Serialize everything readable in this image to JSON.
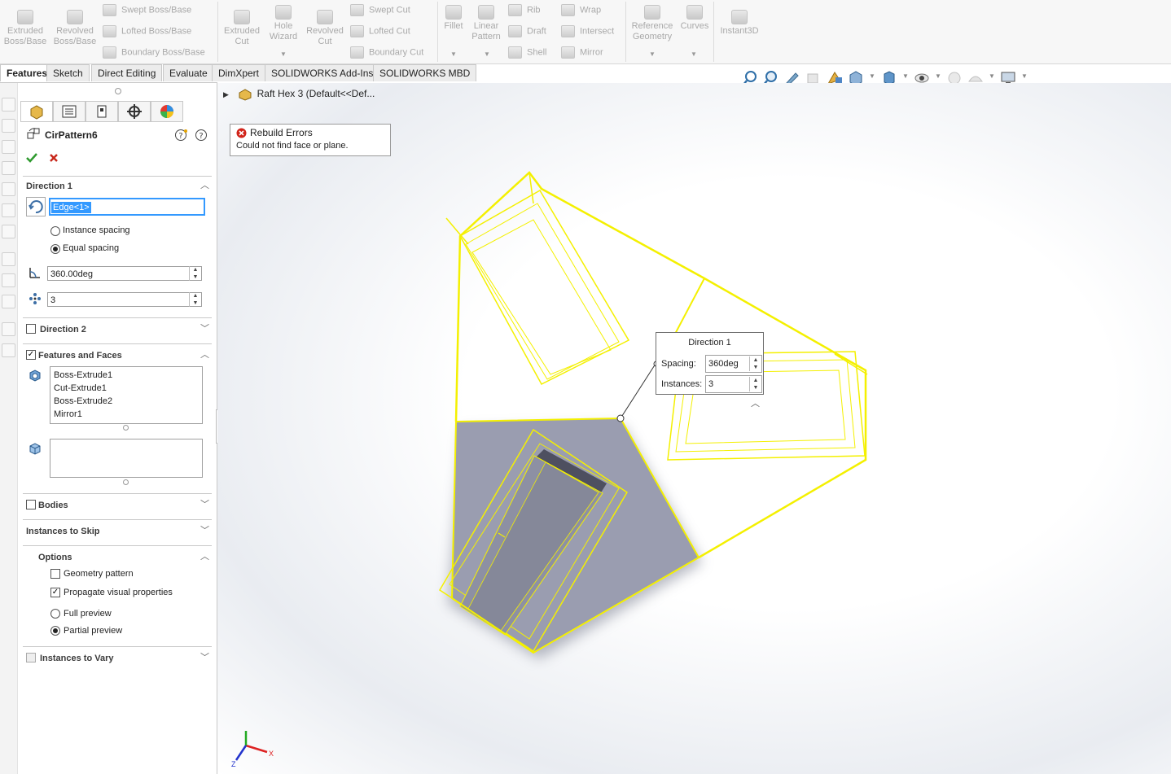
{
  "ribbon": {
    "extruded_boss": "Extruded Boss/Base",
    "revolved_boss": "Revolved Boss/Base",
    "swept_boss": "Swept Boss/Base",
    "lofted_boss": "Lofted Boss/Base",
    "boundary_boss": "Boundary Boss/Base",
    "extruded_cut": "Extruded Cut",
    "hole_wizard": "Hole Wizard",
    "revolved_cut": "Revolved Cut",
    "swept_cut": "Swept Cut",
    "lofted_cut": "Lofted Cut",
    "boundary_cut": "Boundary Cut",
    "fillet": "Fillet",
    "linear_pattern": "Linear Pattern",
    "rib": "Rib",
    "draft": "Draft",
    "shell": "Shell",
    "wrap": "Wrap",
    "intersect": "Intersect",
    "mirror": "Mirror",
    "reference_geometry": "Reference Geometry",
    "curves": "Curves",
    "instant3d": "Instant3D"
  },
  "tabs": [
    "Features",
    "Sketch",
    "Direct Editing",
    "Evaluate",
    "DimXpert",
    "SOLIDWORKS Add-Ins",
    "SOLIDWORKS MBD"
  ],
  "panel": {
    "title": "CirPattern6",
    "direction1": {
      "heading": "Direction 1",
      "edge_value": "Edge<1>",
      "instance_spacing": "Instance spacing",
      "equal_spacing": "Equal spacing",
      "angle": "360.00deg",
      "count": "3"
    },
    "direction2": {
      "heading": "Direction 2"
    },
    "features_and_faces": {
      "heading": "Features and Faces",
      "items": [
        "Boss-Extrude1",
        "Cut-Extrude1",
        "Boss-Extrude2",
        "Mirror1"
      ]
    },
    "bodies": {
      "heading": "Bodies"
    },
    "instances_to_skip": {
      "heading": "Instances to Skip"
    },
    "options": {
      "heading": "Options",
      "geometry_pattern": "Geometry pattern",
      "propagate": "Propagate visual properties",
      "full_preview": "Full preview",
      "partial_preview": "Partial preview"
    },
    "instances_to_vary": {
      "heading": "Instances to Vary"
    }
  },
  "tree": {
    "item": "Raft Hex 3  (Default<<Def..."
  },
  "error": {
    "title": "Rebuild Errors",
    "message": "Could not find face or plane."
  },
  "callout": {
    "title": "Direction 1",
    "spacing_label": "Spacing:",
    "spacing_value": "360deg",
    "instances_label": "Instances:",
    "instances_value": "3"
  },
  "triad": {
    "x": "X",
    "z": "Z"
  },
  "colors": {
    "preview": "#f4f000",
    "body": "#9a9db0",
    "selection": "#3399ff"
  }
}
